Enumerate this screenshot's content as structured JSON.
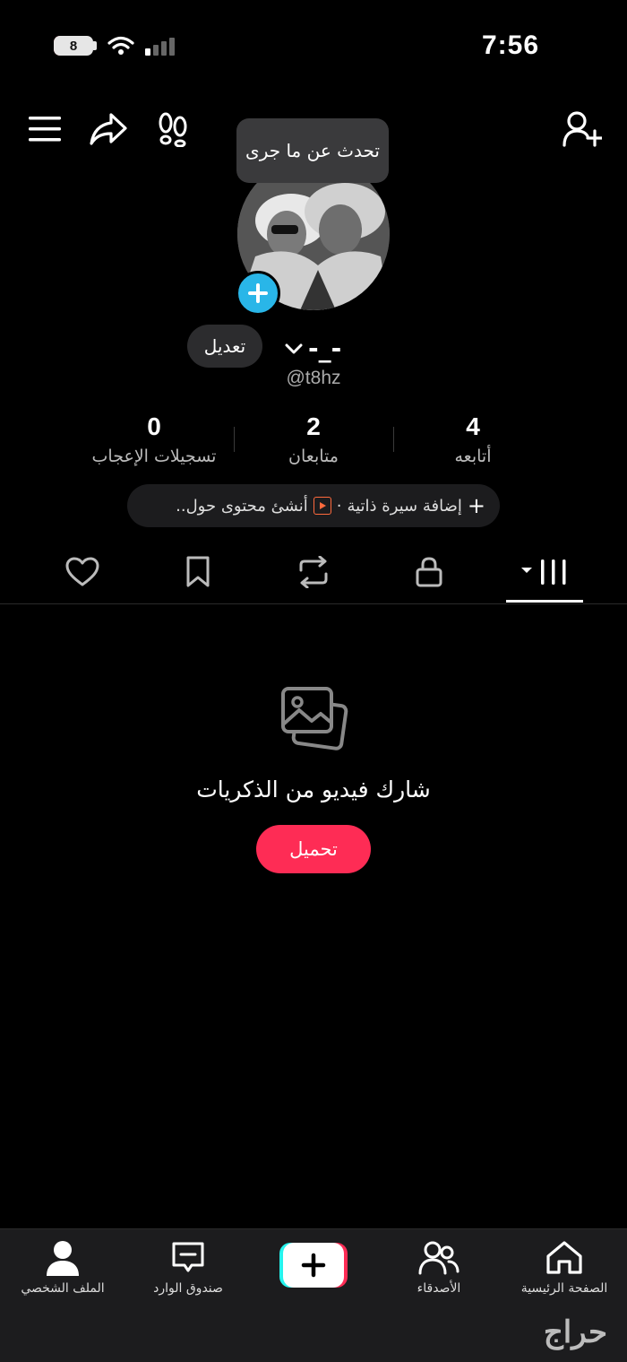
{
  "status_bar": {
    "time": "7:56",
    "battery": "8"
  },
  "tooltip": "تحدث عن ما جرى",
  "profile": {
    "username": "-_-",
    "handle": "@t8hz",
    "edit_label": "تعديل"
  },
  "stats": [
    {
      "value": "4",
      "label": "أتابعه"
    },
    {
      "value": "2",
      "label": "متابعان"
    },
    {
      "value": "0",
      "label": "تسجيلات الإعجاب"
    }
  ],
  "bio": {
    "add_label": "إضافة سيرة ذاتية",
    "separator": "·",
    "create_label": "أنشئ محتوى حول.."
  },
  "tabs": [
    {
      "name": "videos",
      "icon": "grid-icon",
      "active": true
    },
    {
      "name": "private",
      "icon": "lock-icon",
      "active": false
    },
    {
      "name": "reposts",
      "icon": "repost-icon",
      "active": false
    },
    {
      "name": "saved",
      "icon": "bookmark-icon",
      "active": false
    },
    {
      "name": "liked",
      "icon": "heart-icon",
      "active": false
    }
  ],
  "empty_state": {
    "title": "شارك فيديو من الذكريات",
    "button_label": "تحميل"
  },
  "bottom_nav": [
    {
      "label": "الصفحة الرئيسية",
      "icon": "home-icon"
    },
    {
      "label": "الأصدقاء",
      "icon": "friends-icon"
    },
    {
      "label": "",
      "icon": "create-plus-icon"
    },
    {
      "label": "صندوق الوارد",
      "icon": "inbox-icon"
    },
    {
      "label": "الملف الشخصي",
      "icon": "profile-icon"
    }
  ],
  "watermark": "حراج",
  "colors": {
    "accent": "#fe2c55",
    "badge_blue": "#29b6e8",
    "pill_bg": "#2c2c2e"
  }
}
